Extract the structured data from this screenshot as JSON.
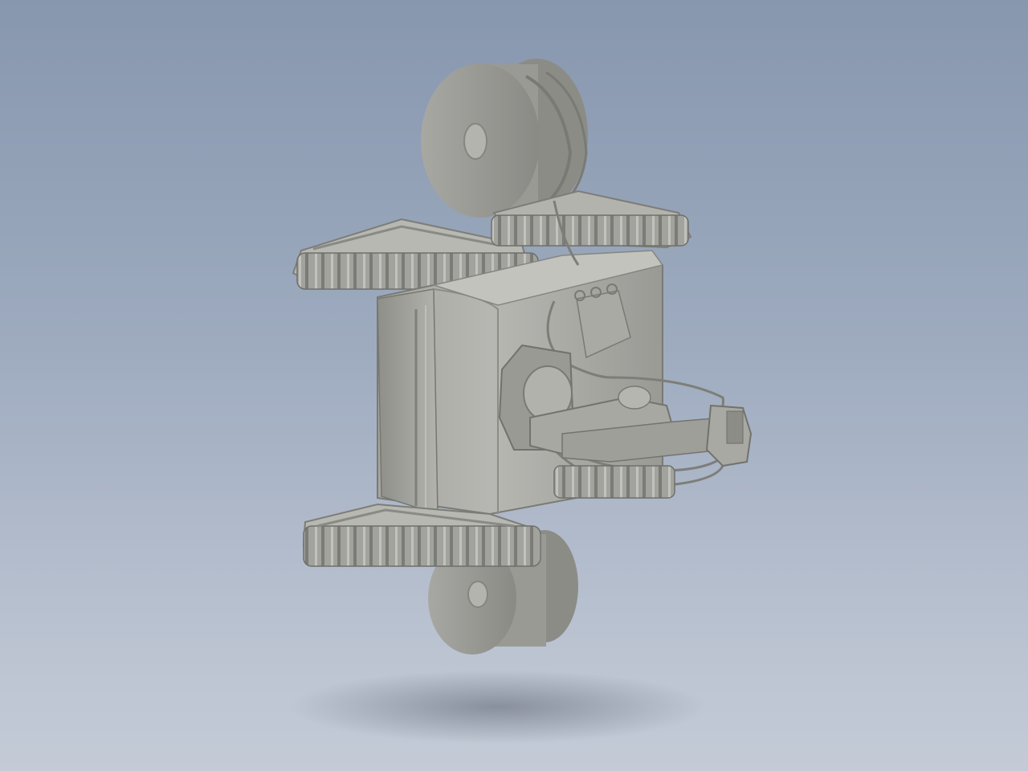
{
  "scene": {
    "subject_icon": "tracked-robot-cad-model-icon",
    "colors": {
      "background_top": "#8797ae",
      "background_bottom": "#c4cbd7",
      "model_light": "#b9b9b4",
      "model_mid": "#9e9e99",
      "model_dark": "#6f6f6b",
      "shadow": "#6e7480"
    }
  }
}
